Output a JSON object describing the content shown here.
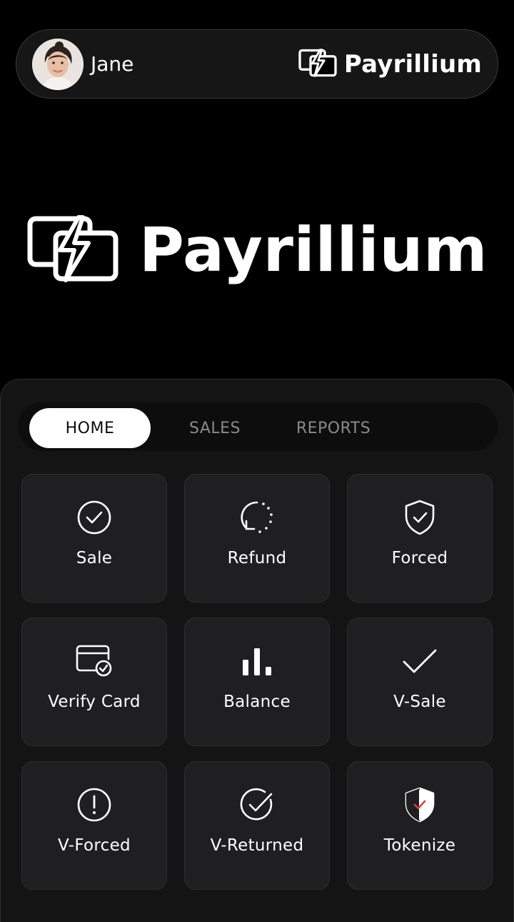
{
  "header": {
    "user_name": "Jane",
    "brand": "Payrillium"
  },
  "hero": {
    "brand": "Payrillium"
  },
  "tabs": [
    {
      "label": "HOME",
      "active": true
    },
    {
      "label": "SALES",
      "active": false
    },
    {
      "label": "REPORTS",
      "active": false
    }
  ],
  "tiles": [
    {
      "label": "Sale",
      "icon": "check-circle-icon"
    },
    {
      "label": "Refund",
      "icon": "refund-icon"
    },
    {
      "label": "Forced",
      "icon": "shield-check-icon"
    },
    {
      "label": "Verify Card",
      "icon": "card-verify-icon"
    },
    {
      "label": "Balance",
      "icon": "bar-chart-icon"
    },
    {
      "label": "V-Sale",
      "icon": "checkmark-icon"
    },
    {
      "label": "V-Forced",
      "icon": "alert-circle-icon"
    },
    {
      "label": "V-Returned",
      "icon": "check-circle-icon"
    },
    {
      "label": "Tokenize",
      "icon": "shield-token-icon"
    }
  ],
  "colors": {
    "background": "#000000",
    "panel": "#141414",
    "tile": "#1f1f21",
    "accent_red": "#d14545"
  }
}
